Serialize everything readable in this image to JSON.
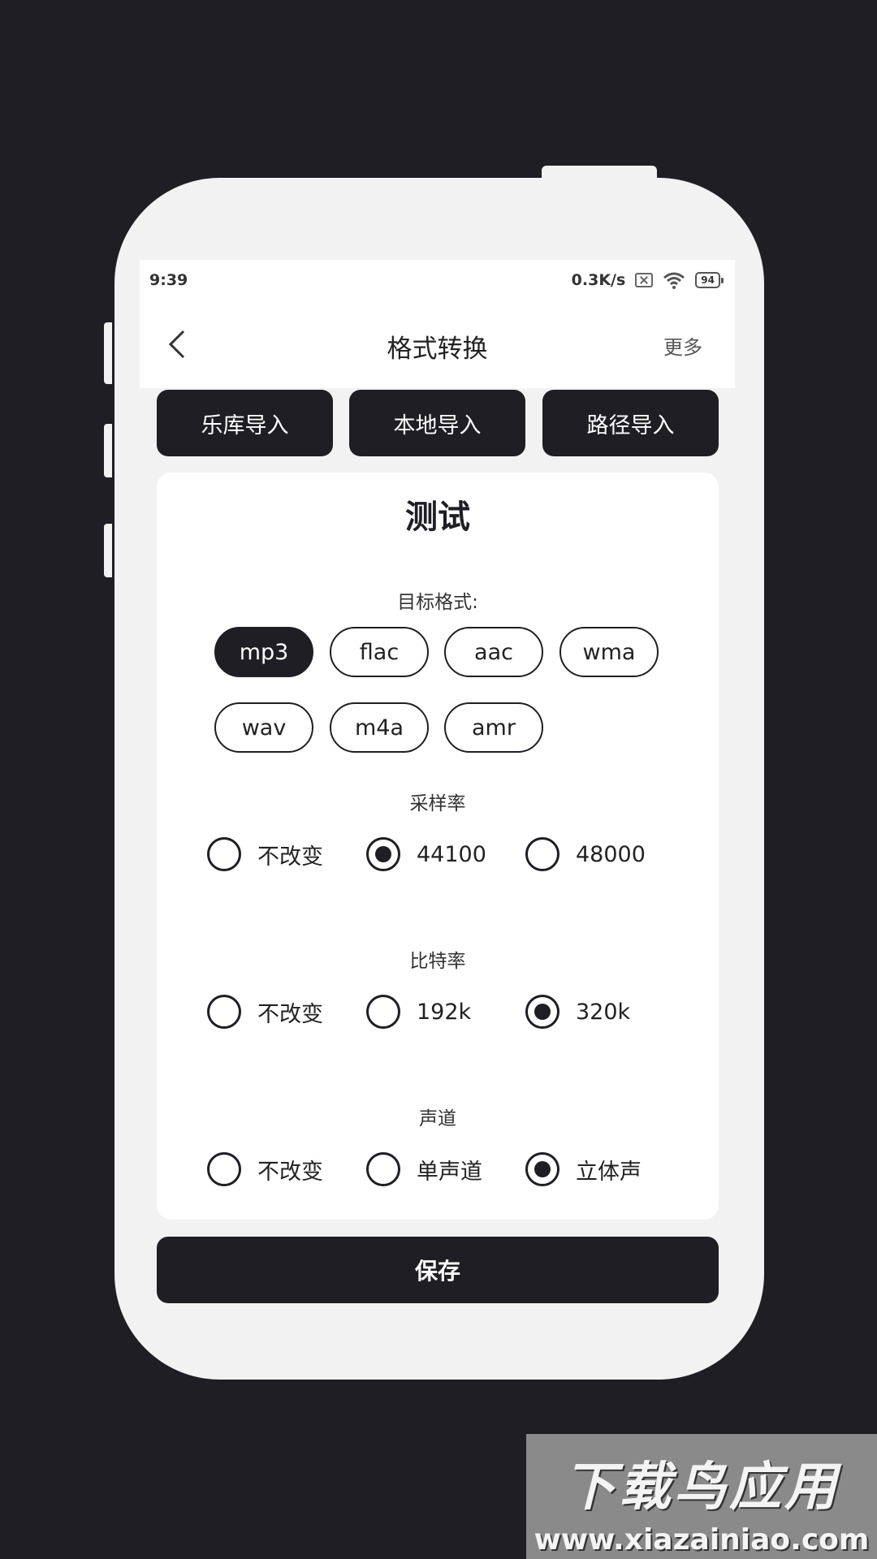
{
  "status_bar": {
    "time": "9:39",
    "network_speed": "0.3K/s",
    "battery": "94"
  },
  "header": {
    "title": "格式转换",
    "more_label": "更多"
  },
  "import_buttons": [
    "乐库导入",
    "本地导入",
    "路径导入"
  ],
  "card": {
    "title": "测试",
    "target_format_label": "目标格式:",
    "formats": [
      "mp3",
      "flac",
      "aac",
      "wma",
      "wav",
      "m4a",
      "amr"
    ],
    "selected_format": "mp3",
    "sample_rate": {
      "label": "采样率",
      "options": [
        "不改变",
        "44100",
        "48000"
      ],
      "selected": "44100"
    },
    "bitrate": {
      "label": "比特率",
      "options": [
        "不改变",
        "192k",
        "320k"
      ],
      "selected": "320k"
    },
    "channel": {
      "label": "声道",
      "options": [
        "不改变",
        "单声道",
        "立体声"
      ],
      "selected": "立体声"
    }
  },
  "save_label": "保存",
  "watermark": {
    "main": "下载鸟应用",
    "sub": "www.xiazainiao.com"
  },
  "colors": {
    "background": "#1e1e24",
    "phone_frame": "#f2f2f2",
    "accent_dark": "#1e1e24"
  }
}
